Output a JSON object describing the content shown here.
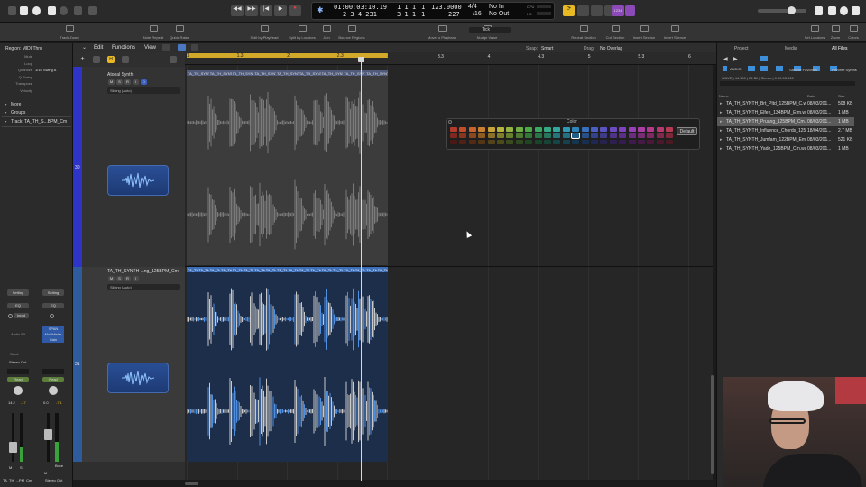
{
  "transport": {
    "time": "01:00:03:10.19",
    "bars": "2 3 4 231",
    "locator_top": "1  1  1",
    "locator_bottom": "3  1  1",
    "locator_right_top": "1",
    "locator_right_bottom": "1",
    "tempo": "123.0000",
    "tempo_sub": "227",
    "sig_top": "4/4",
    "sig_bottom": "/16",
    "in": "No In",
    "out": "No Out",
    "cpu_label": "CPU",
    "hd_label": "HD",
    "count_in": "1234"
  },
  "toolbar": {
    "items": [
      "Track Zoom",
      "Note Repeat",
      "Quick Raise",
      "Split by Playhead",
      "Split by Locators",
      "Join",
      "Bounce Regions",
      "Move to Playhead",
      "Nudge Value",
      "Repeat Section",
      "Cut Section",
      "Insert Section",
      "Insert Silence",
      "Set Locators",
      "Zoom",
      "Colors"
    ],
    "nudge_value": "Tick"
  },
  "inspector": {
    "region_title": "Region: MIDI Thru",
    "params": [
      {
        "label": "Mute",
        "value": ""
      },
      {
        "label": "Loop",
        "value": ""
      },
      {
        "label": "Quantize",
        "value": "1/16 Swing A"
      },
      {
        "label": "Q-Swing",
        "value": ""
      },
      {
        "label": "Transpose",
        "value": ""
      },
      {
        "label": "Velocity",
        "value": ""
      }
    ],
    "more": "More",
    "groups": "Groups",
    "track_title": "Track: TA_TH_S...BPM_Cm",
    "strip1": {
      "setting": "Setting",
      "eq": "EQ",
      "input": "Input",
      "audio_fx": "Audio FX",
      "send": "Send",
      "output": "Stereo Out",
      "read": "Read",
      "vol": "14.2",
      "pan": "-17",
      "name": "TA_TH_...PM_Cm"
    },
    "strip2": {
      "setting": "Setting",
      "eq": "EQ",
      "plugins": [
        "SPAN",
        "MultiMeter",
        "Gain"
      ],
      "read": "Read",
      "vol": "0.0",
      "pan": "-7.1",
      "name": "Stereo Out",
      "bnce": "Bnce"
    }
  },
  "tracks_header": {
    "edit": "Edit",
    "functions": "Functions",
    "view": "View",
    "snap_label": "Snap:",
    "snap_value": "Smart",
    "drag_label": "Drag:",
    "drag_value": "No Overlap"
  },
  "tracks": [
    {
      "number": "30",
      "name": "Atonal Synth",
      "mode": "Slicing (Auto)",
      "buttons": [
        "M",
        "S",
        "R",
        "I",
        "D"
      ]
    },
    {
      "number": "31",
      "name": "TA_TH_SYNTH ...ng_125BPM_Cm",
      "mode": "Slicing (Auto)",
      "buttons": [
        "M",
        "S",
        "R",
        "I"
      ]
    }
  ],
  "ruler": [
    "1",
    "1.3",
    "2",
    "2.3",
    "3",
    "3.3",
    "4",
    "4.3",
    "5",
    "5.3",
    "6"
  ],
  "region_labels": {
    "track30": "TA_TH_SYNT",
    "track31": "TA_TH"
  },
  "color_picker": {
    "title": "Color",
    "default_button": "Default",
    "colors": [
      [
        "#b43a2e",
        "#c14e2b",
        "#c7632d",
        "#c98131",
        "#c7a33a",
        "#b5b53d",
        "#93b442",
        "#6fae45",
        "#4ba94a",
        "#3aa762",
        "#33a883",
        "#34a6a0",
        "#3199b3",
        "#2f84ba",
        "#3970be",
        "#4a5fc1",
        "#5b53c2",
        "#6c4ac0",
        "#7f43bd",
        "#9641b7",
        "#a93fa4",
        "#b53a8c",
        "#b8396f",
        "#b63a52"
      ],
      [
        "#7e2822",
        "#87371f",
        "#8c4620",
        "#8e5b22",
        "#8c7229",
        "#7f7f2b",
        "#67802e",
        "#4e7b31",
        "#357734",
        "#297545",
        "#24765c",
        "#25757a",
        "#237082",
        "#215e86",
        "#284f87",
        "#344389",
        "#403b89",
        "#4d3487",
        "#5a3085",
        "#6a2e81",
        "#772c73",
        "#7f2962",
        "#81284e",
        "#80283a"
      ],
      [
        "#4a1916",
        "#502114",
        "#532a15",
        "#543616",
        "#53441a",
        "#4b4b1b",
        "#3c4b1d",
        "#2e481f",
        "#1f4621",
        "#19452a",
        "#164536",
        "#164547",
        "#15424d",
        "#14374f",
        "#182f50",
        "#1f2851",
        "#262351",
        "#2d1f50",
        "#351c4f",
        "#3e1b4c",
        "#461a44",
        "#4b183a",
        "#4c182e",
        "#4c1822"
      ]
    ]
  },
  "browser": {
    "tabs": [
      "Project",
      "Media",
      "All Files"
    ],
    "breadcrumb": [
      "AUDIO",
      "Sample Favorites",
      "Favorite Synths"
    ],
    "info": "WAVE  |  44.100  |  24 Bit  |  Stereo  |  0:00:03.845",
    "columns": [
      "Name",
      "Date",
      "Size"
    ],
    "files": [
      {
        "name": "TA_TH_SYNTH_Brt_Pltd_125BPM_C.wav",
        "date": "08/03/201...",
        "size": "508 KB"
      },
      {
        "name": "TA_TH_SYNTH_Elfen_134BPM_Efm.wav",
        "date": "08/03/201...",
        "size": "1 MB"
      },
      {
        "name": "TA_TH_SYNTH_Pruang_125BPM_Cm.wav",
        "date": "08/03/201...",
        "size": "1 MB"
      },
      {
        "name": "TA_TH_SYNTH_Influence_Chords_125...",
        "date": "18/04/201...",
        "size": "2.7 MB"
      },
      {
        "name": "TA_TH_SYNTH_Jumfam_122BPM_Em.wav",
        "date": "08/03/201...",
        "size": "521 KB"
      },
      {
        "name": "TA_TH_SYNTH_Yade_125BPM_Cm.wav",
        "date": "08/03/201...",
        "size": "1 MB"
      }
    ],
    "selected_index": 2
  }
}
